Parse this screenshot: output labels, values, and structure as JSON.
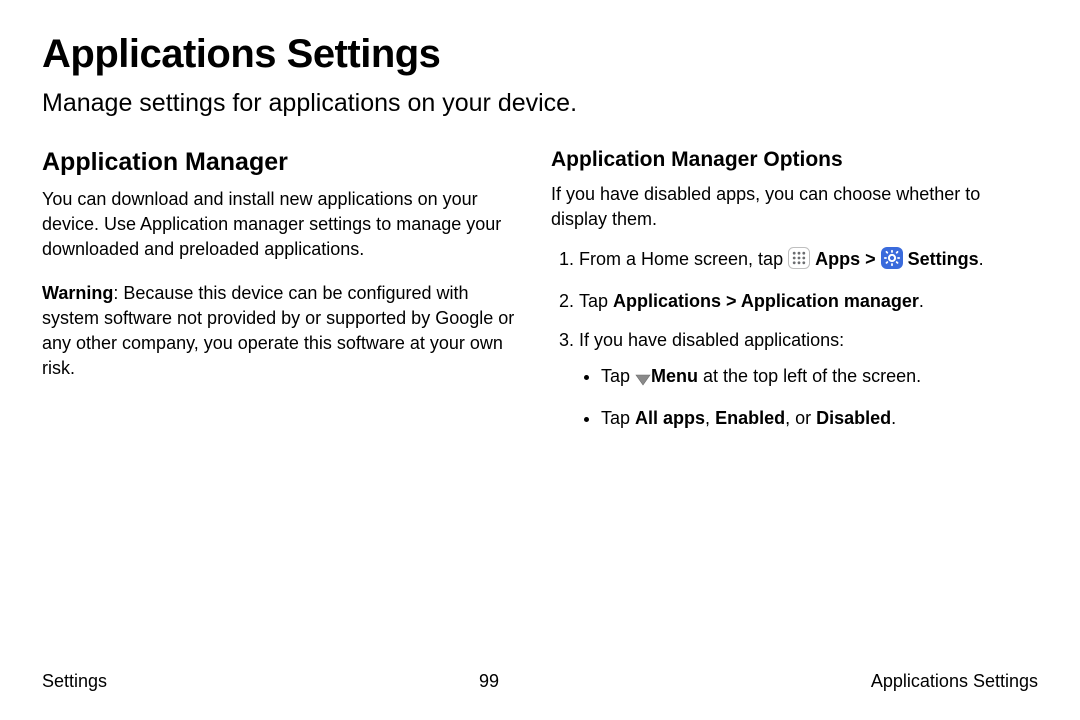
{
  "title": "Applications Settings",
  "subtitle": "Manage settings for applications on your device.",
  "left": {
    "heading": "Application Manager",
    "para1": "You can download and install new applications on your device. Use Application manager settings to manage your downloaded and preloaded applications.",
    "warningLabel": "Warning",
    "warningText": ": Because this device can be configured with system software not provided by or supported by Google or any other company, you operate this software at your own risk."
  },
  "right": {
    "heading": "Application Manager Options",
    "intro": "If you have disabled apps, you can choose whether to display them.",
    "step1_pre": "From a Home screen, tap ",
    "step1_apps": "Apps",
    "step1_sep": " > ",
    "step1_settings": "Settings",
    "step1_tail": ".",
    "step2_pre": "Tap ",
    "step2_bold": "Applications > Application manager",
    "step2_tail": ".",
    "step3": "If you have disabled applications:",
    "bullet1_pre": "Tap ",
    "bullet1_bold": "Menu",
    "bullet1_tail": "  at the top left of the screen.",
    "bullet2_pre": "Tap ",
    "bullet2_b1": "All apps",
    "bullet2_sep1": ", ",
    "bullet2_b2": "Enabled",
    "bullet2_sep2": ", or ",
    "bullet2_b3": "Disabled",
    "bullet2_tail": "."
  },
  "footer": {
    "left": "Settings",
    "center": "99",
    "right": "Applications Settings"
  }
}
